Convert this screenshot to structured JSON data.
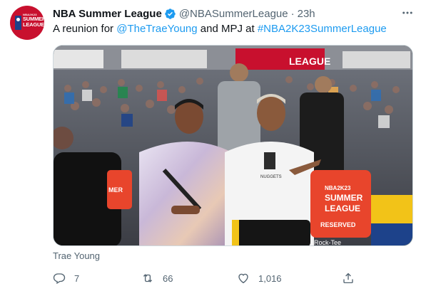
{
  "tweet": {
    "display_name": "NBA Summer League",
    "handle": "@NBASummerLeague",
    "separator": "·",
    "time": "23h",
    "avatar": {
      "line1": "NBA2K23",
      "line2": "SUMMER",
      "line3": "LEAGUE"
    },
    "text": {
      "prefix": "A reunion for ",
      "mention": "@TheTraeYoung",
      "middle": " and MPJ at ",
      "hashtag": "#NBA2K23SummerLeague"
    },
    "photo": {
      "banner_text": "LEAGUE",
      "sign_line1": "NBA2K23",
      "sign_line2": "SUMMER",
      "sign_line3": "LEAGUE",
      "sign_line4": "RESERVED",
      "left_sign_text": "MER",
      "shirt_text": "NUGGETS",
      "shorts_text": "Rock-Tee"
    },
    "caption": "Trae Young",
    "actions": {
      "reply_count": "7",
      "retweet_count": "66",
      "like_count": "1,016"
    }
  },
  "colors": {
    "link": "#1d9bf0",
    "secondary_text": "#536471",
    "brand_red": "#c8102e",
    "verified": "#1d9bf0"
  },
  "icons": {
    "verified": "verified-badge-icon",
    "more": "more-dots-icon",
    "reply": "reply-icon",
    "retweet": "retweet-icon",
    "like": "heart-icon",
    "share": "share-icon"
  }
}
